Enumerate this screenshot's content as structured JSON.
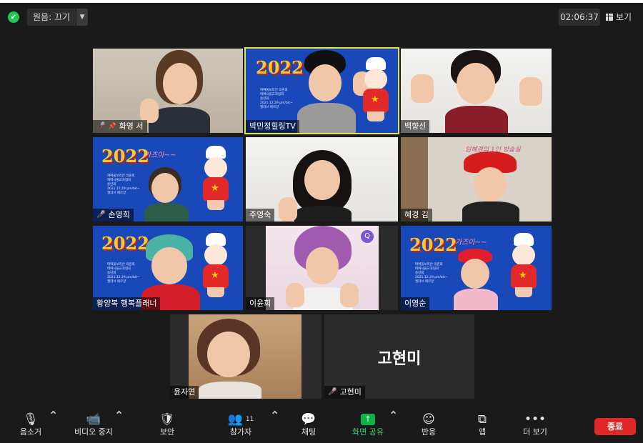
{
  "topbar": {
    "view_mode_label": "원음: 끄기",
    "timer": "02:06:37",
    "view_label": "보기"
  },
  "slide": {
    "year": "2022",
    "tagline": "가즈아~~",
    "lines": [
      "여여울보리안 의원회",
      "여여시울교과협회",
      "송년회",
      "2021.12.29 pm/bit~",
      "엘리브 에르양"
    ]
  },
  "participants": [
    {
      "name": "화영 서",
      "muted": true,
      "pinned": true
    },
    {
      "name": "박민정힐링TV",
      "muted": false,
      "speaking": true
    },
    {
      "name": "백향선",
      "muted": false
    },
    {
      "name": "손영희",
      "muted": true
    },
    {
      "name": "주영숙",
      "muted": false
    },
    {
      "name": "혜경 김",
      "muted": false
    },
    {
      "name": "황양복 행복플래너",
      "muted": false
    },
    {
      "name": "이윤희",
      "muted": false
    },
    {
      "name": "이영순",
      "muted": false
    },
    {
      "name": "윤자연",
      "muted": false
    },
    {
      "name": "고현미",
      "muted": true,
      "video_off": true
    }
  ],
  "tile_extras": {
    "hyegyeong_banner": "임혜경의 1인 방송실",
    "yoonhee_badge": "Q"
  },
  "toolbar": {
    "mute": "음소거",
    "video": "비디오 중지",
    "security": "보안",
    "participants": "참가자",
    "participants_count": "11",
    "chat": "채팅",
    "share": "화면 공유",
    "reactions": "반응",
    "apps": "앱",
    "more": "더 보기",
    "end": "종료"
  },
  "colors": {
    "share_accent": "#0bb34b",
    "end_button": "#e02828",
    "speaking_outline": "#e6e34b",
    "muted_icon": "#e0454b"
  }
}
